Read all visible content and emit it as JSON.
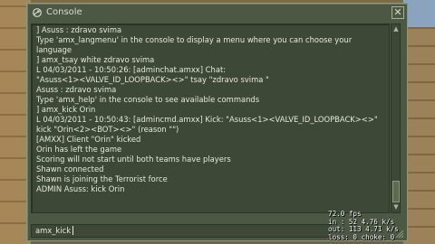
{
  "console": {
    "title": "Console",
    "close_label": "✕",
    "lines": [
      "] Asuss : zdravo svima",
      "Type 'amx_langmenu' in the console to display a menu where you can choose your",
      "language",
      "] amx_tsay white zdravo svima",
      "L 04/03/2011 - 10:50:26: [adminchat.amxx] Chat:",
      "\"Asuss<1><VALVE_ID_LOOPBACK><>\" tsay \"zdravo svima \"",
      "Asuss : zdravo svima",
      "Type 'amx_help' in the console to see available commands",
      "] amx_kick Orin",
      "L 04/03/2011 - 10:50:43: [admincmd.amxx] Kick: \"Asuss<1><VALVE_ID_LOOPBACK><>\"",
      "kick \"Orin<2><BOT><>\" (reason \"\")",
      "[AMXX] Client \"Orin\" kicked",
      "Orin has left the game",
      "Scoring will not start until both teams have players",
      "Shawn connected",
      "Shawn is joining the Terrorist force",
      "ADMIN Asuss: kick Orin"
    ],
    "input_value": "amx_kick"
  },
  "netgraph": {
    "fps": "72.0 fps",
    "in": "in : 52 4.76 k/s",
    "out": "out: 113 4.71 k/s",
    "loss": "loss: 0 choke: 0"
  },
  "colors": {
    "panel": "#4c5844",
    "panel_dark": "#3e4836",
    "border_light": "#8a9a7c",
    "text": "#e6e8dd"
  },
  "icons": {
    "title_icon": "steam-icon",
    "close_icon": "close-icon",
    "scroll_up_icon": "triangle-up-icon",
    "scroll_down_icon": "triangle-down-icon",
    "resize_icon": "resize-grip-icon"
  }
}
